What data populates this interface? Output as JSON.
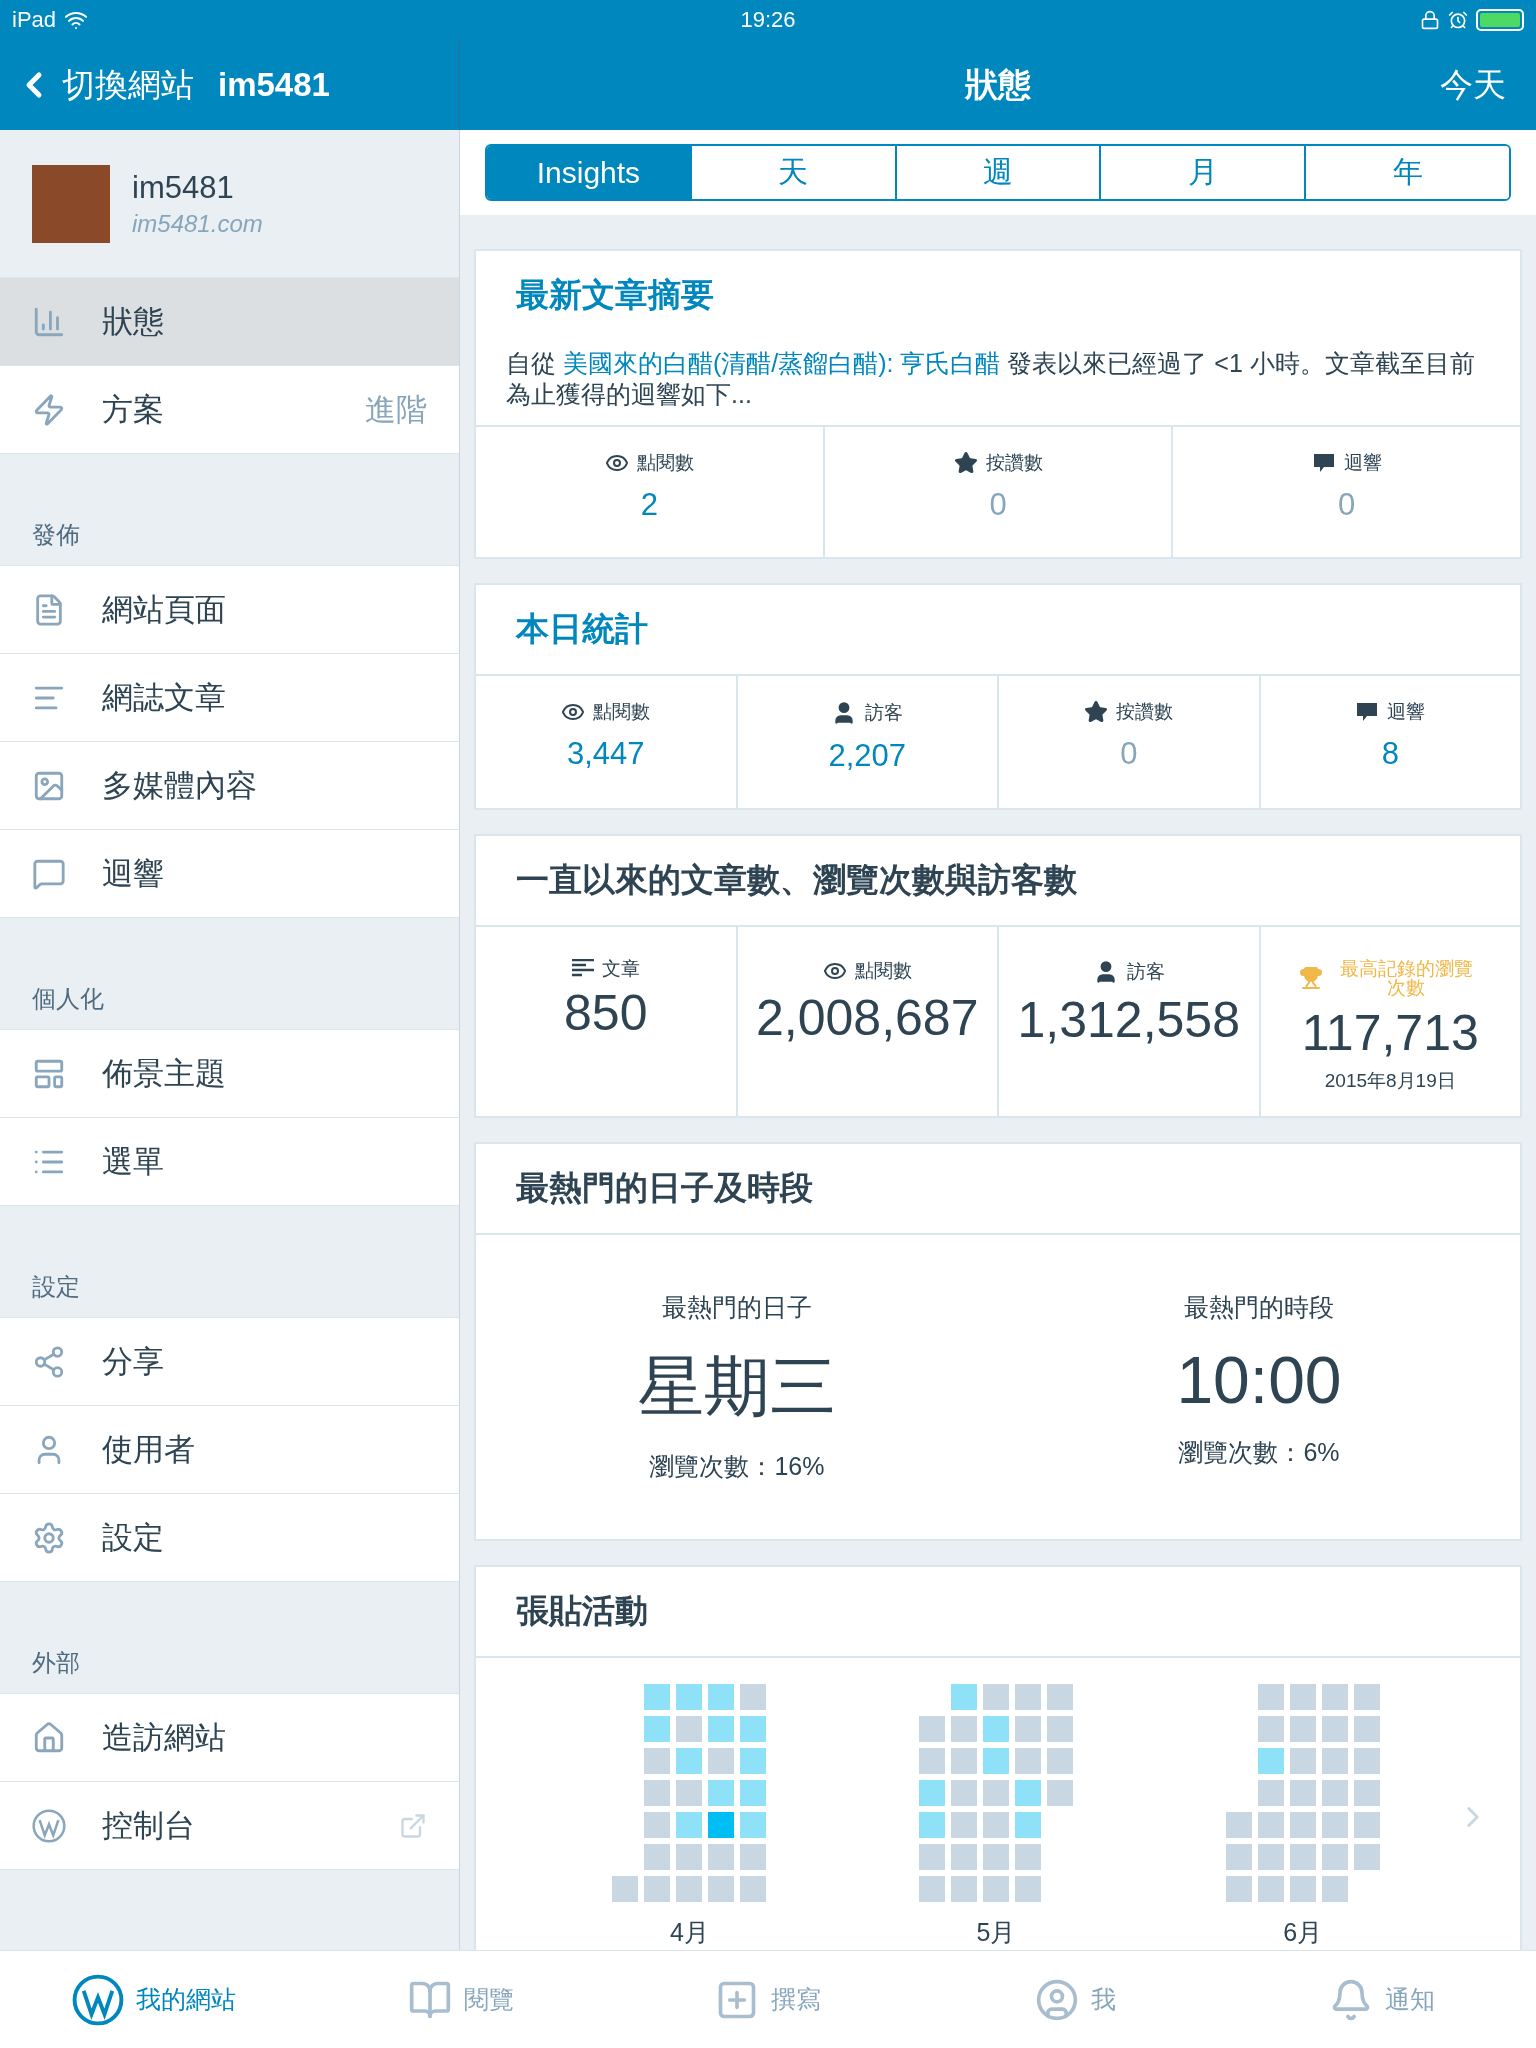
{
  "status_bar": {
    "device": "iPad",
    "time": "19:26"
  },
  "nav": {
    "back": "切換網站",
    "site": "im5481",
    "title": "狀態",
    "action": "今天"
  },
  "site": {
    "name": "im5481",
    "url": "im5481.com"
  },
  "sidebar": [
    {
      "items": [
        {
          "kind": "stats",
          "label": "狀態",
          "selected": true
        },
        {
          "kind": "plan",
          "label": "方案",
          "badge": "進階",
          "selected": false
        }
      ]
    },
    {
      "title": "發佈",
      "items": [
        {
          "kind": "pages",
          "label": "網站頁面",
          "selected": false
        },
        {
          "kind": "posts",
          "label": "網誌文章",
          "selected": false
        },
        {
          "kind": "media",
          "label": "多媒體內容",
          "selected": false
        },
        {
          "kind": "comments",
          "label": "迴響",
          "selected": false
        }
      ]
    },
    {
      "title": "個人化",
      "items": [
        {
          "kind": "themes",
          "label": "佈景主題",
          "selected": false
        },
        {
          "kind": "menus",
          "label": "選單",
          "selected": false
        }
      ]
    },
    {
      "title": "設定",
      "items": [
        {
          "kind": "sharing",
          "label": "分享",
          "selected": false
        },
        {
          "kind": "people",
          "label": "使用者",
          "selected": false
        },
        {
          "kind": "settings",
          "label": "設定",
          "selected": false
        }
      ]
    },
    {
      "title": "外部",
      "items": [
        {
          "kind": "home",
          "label": "造訪網站",
          "selected": false
        },
        {
          "kind": "wp",
          "label": "控制台",
          "selected": false,
          "external": true
        }
      ]
    }
  ],
  "tabs": [
    {
      "label": "Insights",
      "selected": true
    },
    {
      "label": "天",
      "selected": false
    },
    {
      "label": "週",
      "selected": false
    },
    {
      "label": "月",
      "selected": false
    },
    {
      "label": "年",
      "selected": false
    }
  ],
  "latest_post": {
    "title": "最新文章摘要",
    "text_before": "自從",
    "link": "美國來的白醋(清醋/蒸餾白醋): 亨氏白醋",
    "text_after": "發表以來已經過了 <1 小時。文章截至目前為止獲得的迴響如下...",
    "stats": [
      {
        "kind": "views",
        "label": "點閱數",
        "value": "2",
        "active": true
      },
      {
        "kind": "likes",
        "label": "按讚數",
        "value": "0",
        "active": false
      },
      {
        "kind": "comments",
        "label": "迴響",
        "value": "0",
        "active": false
      }
    ]
  },
  "today": {
    "title": "本日統計",
    "stats": [
      {
        "kind": "views",
        "label": "點閱數",
        "value": "3,447",
        "active": true
      },
      {
        "kind": "visitors",
        "label": "訪客",
        "value": "2,207",
        "active": true
      },
      {
        "kind": "likes",
        "label": "按讚數",
        "value": "0",
        "active": false
      },
      {
        "kind": "comments",
        "label": "迴響",
        "value": "8",
        "active": true
      }
    ]
  },
  "all_time": {
    "title": "一直以來的文章數、瀏覽次數與訪客數",
    "stats": [
      {
        "kind": "posts",
        "label": "文章",
        "value": "850"
      },
      {
        "kind": "views",
        "label": "點閱數",
        "value": "2,008,687"
      },
      {
        "kind": "visitors",
        "label": "訪客",
        "value": "1,312,558"
      },
      {
        "kind": "best",
        "label": "最高記錄的瀏覽次數",
        "value": "117,713",
        "date": "2015年8月19日"
      }
    ]
  },
  "most_popular": {
    "title": "最熱門的日子及時段",
    "items": [
      {
        "label": "最熱門的日子",
        "value": "星期三",
        "share": "瀏覽次數：16%"
      },
      {
        "label": "最熱門的時段",
        "value": "10:00",
        "share": "瀏覽次數：6%"
      }
    ]
  },
  "posting_activity": {
    "title": "張貼活動",
    "months": [
      {
        "label": "4月",
        "weeks": [
          [
            {
              "color": "#c8d7e1"
            }
          ],
          [
            {
              "color": "#8fe1f8"
            },
            {
              "color": "#8fe1f8"
            },
            {
              "color": "#c8d7e1"
            },
            {
              "color": "#c8d7e1"
            },
            {
              "color": "#c8d7e1"
            },
            {
              "color": "#c8d7e1"
            },
            {
              "color": "#c8d7e1"
            }
          ],
          [
            {
              "color": "#8fe1f8"
            },
            {
              "color": "#c8d7e1"
            },
            {
              "color": "#8fe1f8"
            },
            {
              "color": "#c8d7e1"
            },
            {
              "color": "#8fe1f8"
            },
            {
              "color": "#c8d7e1"
            },
            {
              "color": "#c8d7e1"
            }
          ],
          [
            {
              "color": "#8fe1f8"
            },
            {
              "color": "#8fe1f8"
            },
            {
              "color": "#c8d7e1"
            },
            {
              "color": "#8fe1f8"
            },
            {
              "color": "#00bdf4"
            },
            {
              "color": "#c8d7e1"
            },
            {
              "color": "#c8d7e1"
            }
          ],
          [
            {
              "color": "#c8d7e1"
            },
            {
              "color": "#8fe1f8"
            },
            {
              "color": "#8fe1f8"
            },
            {
              "color": "#8fe1f8"
            },
            {
              "color": "#8fe1f8"
            },
            {
              "color": "#c8d7e1"
            },
            {
              "color": "#c8d7e1"
            }
          ]
        ]
      },
      {
        "label": "5月",
        "weeks": [
          [
            {
              "color": "#c8d7e1"
            },
            {
              "color": "#c8d7e1"
            },
            {
              "color": "#8fe1f8"
            },
            {
              "color": "#8fe1f8"
            },
            {
              "color": "#c8d7e1"
            },
            {
              "color": "#c8d7e1"
            }
          ],
          [
            {
              "color": "#8fe1f8"
            },
            {
              "color": "#c8d7e1"
            },
            {
              "color": "#c8d7e1"
            },
            {
              "color": "#c8d7e1"
            },
            {
              "color": "#c8d7e1"
            },
            {
              "color": "#c8d7e1"
            },
            {
              "color": "#c8d7e1"
            }
          ],
          [
            {
              "color": "#c8d7e1"
            },
            {
              "color": "#8fe1f8"
            },
            {
              "color": "#8fe1f8"
            },
            {
              "color": "#c8d7e1"
            },
            {
              "color": "#c8d7e1"
            },
            {
              "color": "#c8d7e1"
            },
            {
              "color": "#c8d7e1"
            }
          ],
          [
            {
              "color": "#c8d7e1"
            },
            {
              "color": "#c8d7e1"
            },
            {
              "color": "#c8d7e1"
            },
            {
              "color": "#8fe1f8"
            },
            {
              "color": "#8fe1f8"
            },
            {
              "color": "#c8d7e1"
            },
            {
              "color": "#c8d7e1"
            }
          ],
          [
            {
              "color": "#c8d7e1"
            },
            {
              "color": "#c8d7e1"
            },
            {
              "color": "#c8d7e1"
            },
            {
              "color": "#c8d7e1"
            }
          ]
        ]
      },
      {
        "label": "6月",
        "weeks": [
          [
            {
              "color": "#c8d7e1"
            },
            {
              "color": "#c8d7e1"
            },
            {
              "color": "#c8d7e1"
            }
          ],
          [
            {
              "color": "#c8d7e1"
            },
            {
              "color": "#c8d7e1"
            },
            {
              "color": "#8fe1f8"
            },
            {
              "color": "#c8d7e1"
            },
            {
              "color": "#c8d7e1"
            },
            {
              "color": "#c8d7e1"
            },
            {
              "color": "#c8d7e1"
            }
          ],
          [
            {
              "color": "#c8d7e1"
            },
            {
              "color": "#c8d7e1"
            },
            {
              "color": "#c8d7e1"
            },
            {
              "color": "#c8d7e1"
            },
            {
              "color": "#c8d7e1"
            },
            {
              "color": "#c8d7e1"
            },
            {
              "color": "#c8d7e1"
            }
          ],
          [
            {
              "color": "#c8d7e1"
            },
            {
              "color": "#c8d7e1"
            },
            {
              "color": "#c8d7e1"
            },
            {
              "color": "#c8d7e1"
            },
            {
              "color": "#c8d7e1"
            },
            {
              "color": "#c8d7e1"
            },
            {
              "color": "#c8d7e1"
            }
          ],
          [
            {
              "color": "#c8d7e1"
            },
            {
              "color": "#c8d7e1"
            },
            {
              "color": "#c8d7e1"
            },
            {
              "color": "#c8d7e1"
            },
            {
              "color": "#c8d7e1"
            },
            {
              "color": "#c8d7e1"
            }
          ]
        ]
      }
    ]
  },
  "tab_bar": [
    {
      "kind": "site",
      "label": "我的網站",
      "selected": true
    },
    {
      "kind": "reader",
      "label": "閱覽",
      "selected": false
    },
    {
      "kind": "write",
      "label": "撰寫",
      "selected": false
    },
    {
      "kind": "me",
      "label": "我",
      "selected": false
    },
    {
      "kind": "notifications",
      "label": "通知",
      "selected": false
    }
  ]
}
